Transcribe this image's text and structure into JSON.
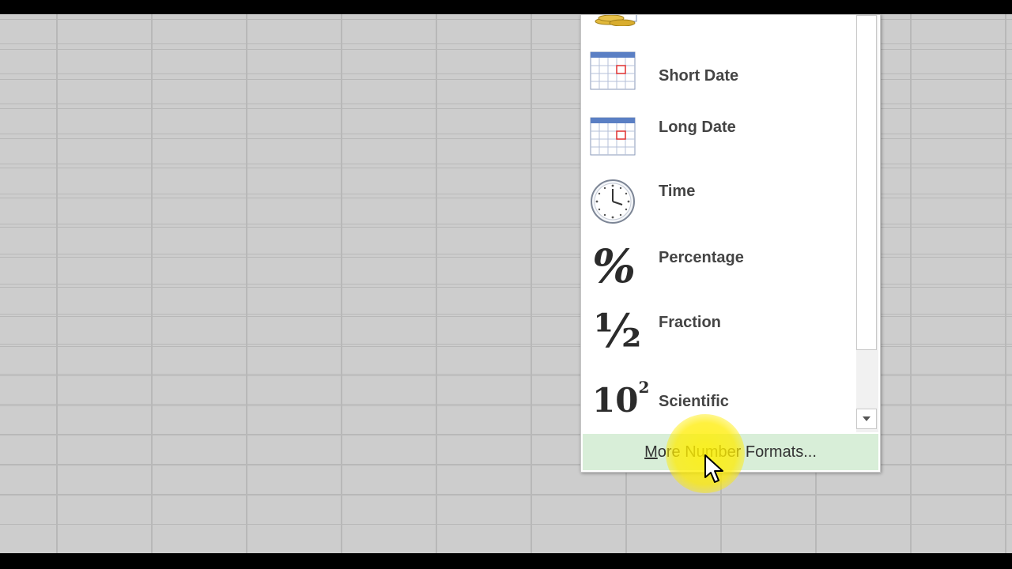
{
  "menu": {
    "items": [
      {
        "label": "Short Date",
        "icon": "calendar-icon"
      },
      {
        "label": "Long Date",
        "icon": "calendar-icon"
      },
      {
        "label": "Time",
        "icon": "clock-icon"
      },
      {
        "label": "Percentage",
        "icon": "percent-icon"
      },
      {
        "label": "Fraction",
        "icon": "fraction-icon"
      },
      {
        "label": "Scientific",
        "icon": "scientific-icon"
      }
    ],
    "more_label_first": "M",
    "more_label_rest": "ore Number Formats...",
    "fraction_glyph": "½",
    "percent_glyph": "%",
    "scientific_base": "10",
    "scientific_exp": "2"
  },
  "colors": {
    "sheet_bg": "#cdcdcd",
    "gridline": "#b8b8b8",
    "menu_label": "#444444",
    "more_bg": "#d8eed8",
    "highlight": "#ffec00"
  }
}
